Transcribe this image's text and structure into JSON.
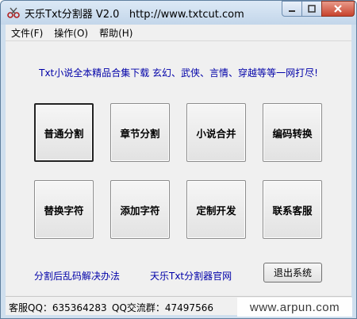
{
  "window": {
    "title": "天乐Txt分割器 V2.0",
    "url": "http://www.txtcut.com",
    "controls": {
      "minimize_icon": "minimize-icon",
      "maximize_icon": "maximize-icon",
      "close_icon": "close-icon"
    }
  },
  "menu": {
    "items": [
      {
        "label": "文件(F)"
      },
      {
        "label": "操作(O)"
      },
      {
        "label": "帮助(H)"
      }
    ]
  },
  "banner": {
    "text": "Txt小说全本精品合集下载 玄幻、武侠、言情、穿越等等一网打尽!"
  },
  "buttons": {
    "row1": [
      {
        "label": "普通分割"
      },
      {
        "label": "章节分割"
      },
      {
        "label": "小说合并"
      },
      {
        "label": "编码转换"
      }
    ],
    "row2": [
      {
        "label": "替换字符"
      },
      {
        "label": "添加字符"
      },
      {
        "label": "定制开发"
      },
      {
        "label": "联系客服"
      }
    ]
  },
  "links": {
    "garbled_fix": "分割后乱码解决办法",
    "official_site": "天乐Txt分割器官网"
  },
  "exit_button": {
    "label": "退出系统"
  },
  "status": {
    "support_qq": "客服QQ：635364283",
    "qq_group": "QQ交流群：47497566"
  },
  "watermark": {
    "text": "www.arpun.com"
  },
  "colors": {
    "link_blue": "#0000a8",
    "close_red": "#c7432d",
    "frame_blue": "#cfdfee"
  }
}
